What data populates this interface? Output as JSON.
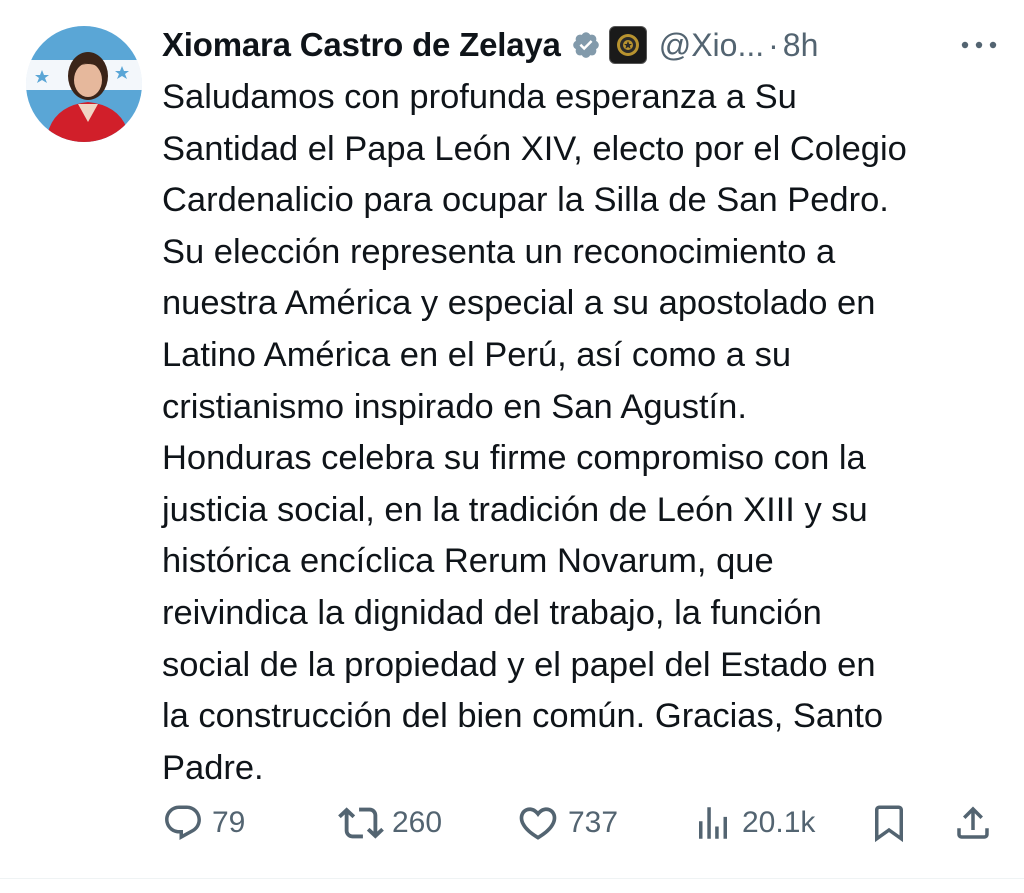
{
  "author": {
    "display_name": "Xiomara Castro de Zelaya",
    "handle": "@Xio...",
    "time": "8h",
    "separator": "·",
    "avatar_icon": "profile-photo"
  },
  "icons": {
    "verified": "verified-badge-icon",
    "affiliate": "affiliate-seal-icon",
    "more": "more-options-icon",
    "reply": "reply-icon",
    "repost": "repost-icon",
    "like": "like-icon",
    "views": "views-icon",
    "bookmark": "bookmark-icon",
    "share": "share-icon"
  },
  "tweet": {
    "lines": [
      "Saludamos con profunda esperanza a Su",
      "Santidad el Papa León XIV, electo por el Colegio",
      "Cardenalicio para ocupar la Silla de San Pedro.",
      "Su elección representa un reconocimiento a",
      "nuestra América y especial a su apostolado en",
      "Latino América en el Perú, así como a su",
      "cristianismo inspirado en San Agustín.",
      "Honduras celebra su firme compromiso con la",
      "justicia social, en la tradición de León XIII y su",
      "histórica encíclica Rerum Novarum, que",
      "reivindica la dignidad del trabajo, la función",
      "social de la propiedad y el papel del Estado en",
      "la construcción del bien común. Gracias, Santo",
      "Padre."
    ]
  },
  "metrics": {
    "replies": "79",
    "reposts": "260",
    "likes": "737",
    "views": "20.1k"
  },
  "colors": {
    "text": "#0f1419",
    "secondary": "#536471",
    "verified": "#829aab"
  }
}
